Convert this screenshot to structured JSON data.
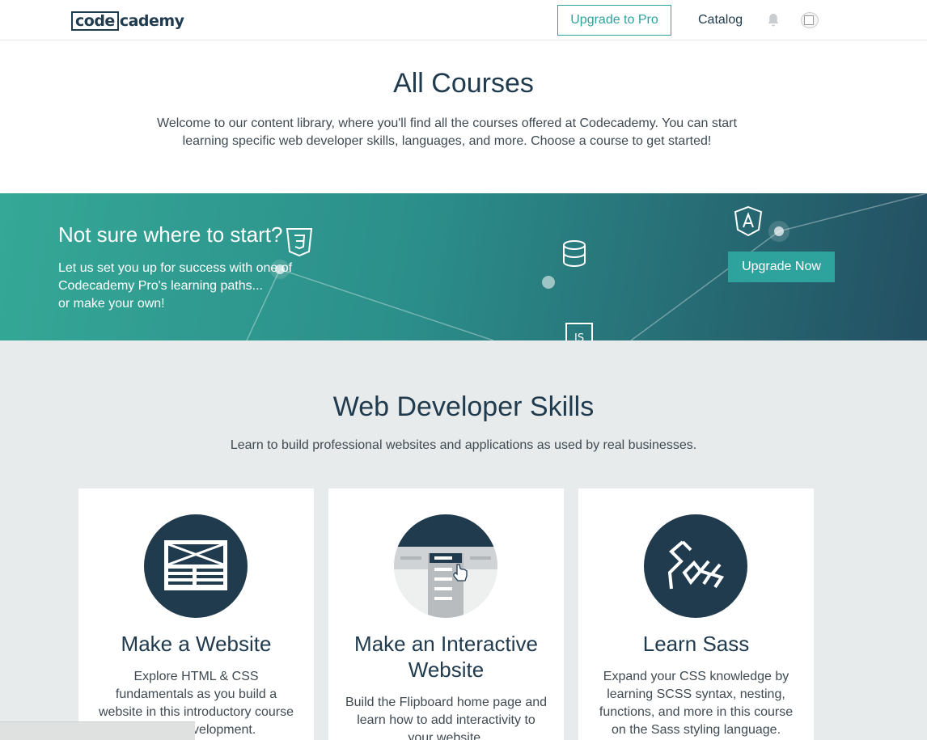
{
  "header": {
    "logo_boxed": "code",
    "logo_rest": "cademy",
    "upgrade_pro_label": "Upgrade to Pro",
    "catalog_label": "Catalog",
    "bell_icon": "bell-icon",
    "avatar_icon": "avatar-broken-image"
  },
  "intro": {
    "title": "All Courses",
    "description": "Welcome to our content library, where you'll find all the courses offered at Codecademy. You can start learning specific web developer skills, languages, and more. Choose a course to get started!"
  },
  "banner": {
    "title": "Not sure where to start?",
    "text_line1": "Let us set you up for success with one of",
    "text_line2": "Codecademy Pro's learning paths...",
    "text_line3": "or make your own!",
    "upgrade_now_label": "Upgrade Now",
    "icons": [
      "css3-icon",
      "database-icon",
      "angular-icon",
      "js-icon"
    ],
    "js_label": "JS"
  },
  "skills": {
    "title": "Web Developer Skills",
    "subtitle": "Learn to build professional websites and applications as used by real businesses.",
    "cards": [
      {
        "title": "Make a Website",
        "description": "Explore HTML & CSS fundamentals as you build a website in this introductory course to web development.",
        "icon": "website-layout-icon"
      },
      {
        "title": "Make an Interactive Website",
        "description": "Build the Flipboard home page and learn how to add interactivity to your website.",
        "icon": "interactive-website-icon"
      },
      {
        "title": "Learn Sass",
        "description": "Expand your CSS knowledge by learning SCSS syntax, nesting, functions, and more in this course on the Sass styling language.",
        "icon": "sass-icon"
      }
    ]
  },
  "colors": {
    "navy": "#203a4e",
    "teal": "#2ea39d",
    "section_bg": "#e8ebeb"
  }
}
